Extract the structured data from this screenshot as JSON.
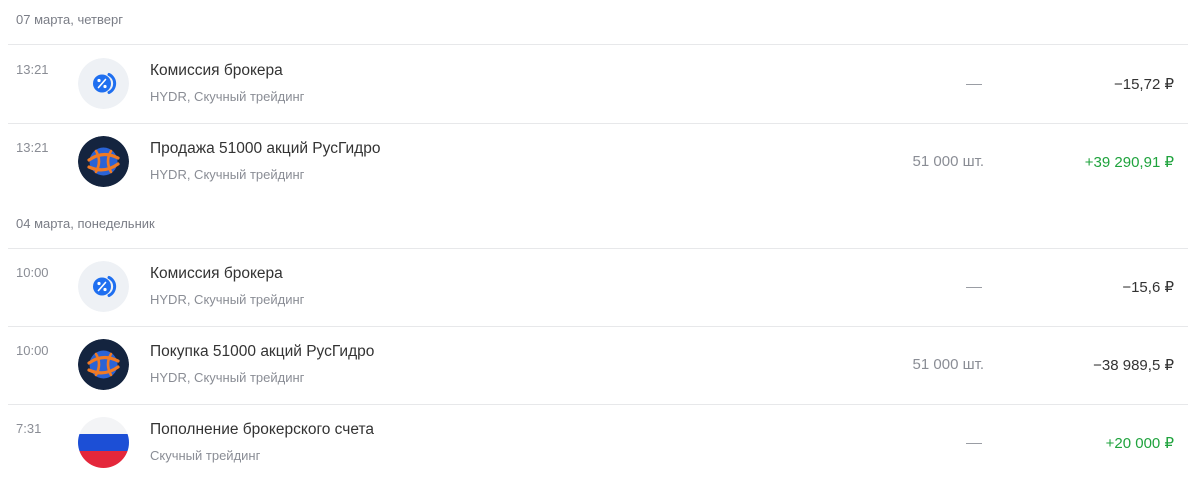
{
  "groups": [
    {
      "date": "07 марта, четверг",
      "operations": [
        {
          "time": "13:21",
          "icon": "broker-commission-icon",
          "title": "Комиссия брокера",
          "subtitle": "HYDR, Скучный трейдинг",
          "quantity": "",
          "amount": "−15,72 ₽",
          "amount_type": "negative"
        },
        {
          "time": "13:21",
          "icon": "rushydro-logo-icon",
          "title": "Продажа 51000 акций РусГидро",
          "subtitle": "HYDR, Скучный трейдинг",
          "quantity": "51 000 шт.",
          "amount": "+39 290,91 ₽",
          "amount_type": "positive"
        }
      ]
    },
    {
      "date": "04 марта, понедельник",
      "operations": [
        {
          "time": "10:00",
          "icon": "broker-commission-icon",
          "title": "Комиссия брокера",
          "subtitle": "HYDR, Скучный трейдинг",
          "quantity": "",
          "amount": "−15,6 ₽",
          "amount_type": "negative"
        },
        {
          "time": "10:00",
          "icon": "rushydro-logo-icon",
          "title": "Покупка 51000 акций РусГидро",
          "subtitle": "HYDR, Скучный трейдинг",
          "quantity": "51 000 шт.",
          "amount": "−38 989,5 ₽",
          "amount_type": "negative"
        },
        {
          "time": "7:31",
          "icon": "russian-flag-icon",
          "title": "Пополнение брокерского счета",
          "subtitle": "Скучный трейдинг",
          "quantity": "",
          "amount": "+20 000 ₽",
          "amount_type": "positive"
        }
      ]
    }
  ],
  "colors": {
    "positive": "#1fa33d",
    "text": "#333333",
    "muted": "#8a8d95",
    "commission_icon": "#1f6ff0",
    "rushydro_bg": "#14243f"
  }
}
